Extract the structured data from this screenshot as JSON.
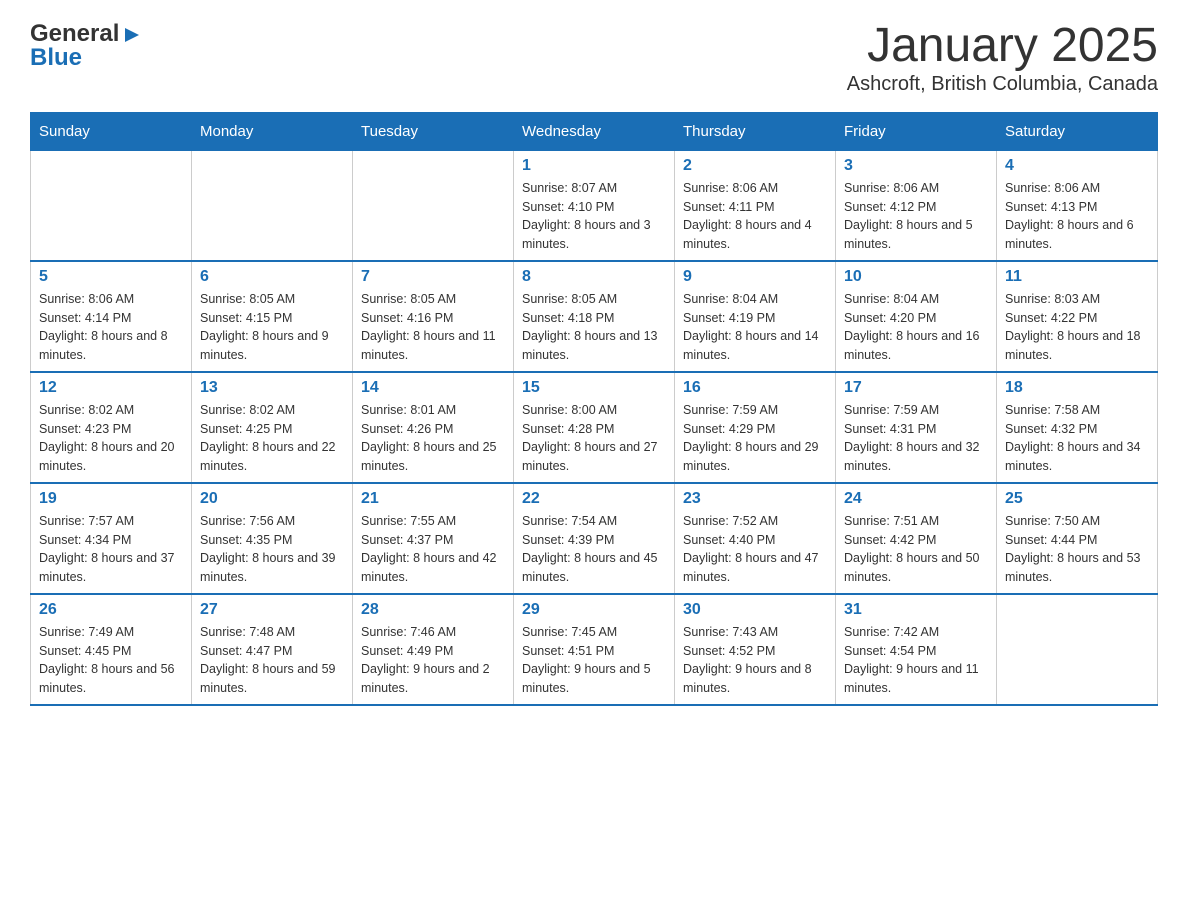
{
  "header": {
    "logo_general": "General",
    "logo_blue": "Blue",
    "title": "January 2025",
    "subtitle": "Ashcroft, British Columbia, Canada"
  },
  "calendar": {
    "days_of_week": [
      "Sunday",
      "Monday",
      "Tuesday",
      "Wednesday",
      "Thursday",
      "Friday",
      "Saturday"
    ],
    "weeks": [
      [
        {
          "day": "",
          "info": ""
        },
        {
          "day": "",
          "info": ""
        },
        {
          "day": "",
          "info": ""
        },
        {
          "day": "1",
          "info": "Sunrise: 8:07 AM\nSunset: 4:10 PM\nDaylight: 8 hours and 3 minutes."
        },
        {
          "day": "2",
          "info": "Sunrise: 8:06 AM\nSunset: 4:11 PM\nDaylight: 8 hours and 4 minutes."
        },
        {
          "day": "3",
          "info": "Sunrise: 8:06 AM\nSunset: 4:12 PM\nDaylight: 8 hours and 5 minutes."
        },
        {
          "day": "4",
          "info": "Sunrise: 8:06 AM\nSunset: 4:13 PM\nDaylight: 8 hours and 6 minutes."
        }
      ],
      [
        {
          "day": "5",
          "info": "Sunrise: 8:06 AM\nSunset: 4:14 PM\nDaylight: 8 hours and 8 minutes."
        },
        {
          "day": "6",
          "info": "Sunrise: 8:05 AM\nSunset: 4:15 PM\nDaylight: 8 hours and 9 minutes."
        },
        {
          "day": "7",
          "info": "Sunrise: 8:05 AM\nSunset: 4:16 PM\nDaylight: 8 hours and 11 minutes."
        },
        {
          "day": "8",
          "info": "Sunrise: 8:05 AM\nSunset: 4:18 PM\nDaylight: 8 hours and 13 minutes."
        },
        {
          "day": "9",
          "info": "Sunrise: 8:04 AM\nSunset: 4:19 PM\nDaylight: 8 hours and 14 minutes."
        },
        {
          "day": "10",
          "info": "Sunrise: 8:04 AM\nSunset: 4:20 PM\nDaylight: 8 hours and 16 minutes."
        },
        {
          "day": "11",
          "info": "Sunrise: 8:03 AM\nSunset: 4:22 PM\nDaylight: 8 hours and 18 minutes."
        }
      ],
      [
        {
          "day": "12",
          "info": "Sunrise: 8:02 AM\nSunset: 4:23 PM\nDaylight: 8 hours and 20 minutes."
        },
        {
          "day": "13",
          "info": "Sunrise: 8:02 AM\nSunset: 4:25 PM\nDaylight: 8 hours and 22 minutes."
        },
        {
          "day": "14",
          "info": "Sunrise: 8:01 AM\nSunset: 4:26 PM\nDaylight: 8 hours and 25 minutes."
        },
        {
          "day": "15",
          "info": "Sunrise: 8:00 AM\nSunset: 4:28 PM\nDaylight: 8 hours and 27 minutes."
        },
        {
          "day": "16",
          "info": "Sunrise: 7:59 AM\nSunset: 4:29 PM\nDaylight: 8 hours and 29 minutes."
        },
        {
          "day": "17",
          "info": "Sunrise: 7:59 AM\nSunset: 4:31 PM\nDaylight: 8 hours and 32 minutes."
        },
        {
          "day": "18",
          "info": "Sunrise: 7:58 AM\nSunset: 4:32 PM\nDaylight: 8 hours and 34 minutes."
        }
      ],
      [
        {
          "day": "19",
          "info": "Sunrise: 7:57 AM\nSunset: 4:34 PM\nDaylight: 8 hours and 37 minutes."
        },
        {
          "day": "20",
          "info": "Sunrise: 7:56 AM\nSunset: 4:35 PM\nDaylight: 8 hours and 39 minutes."
        },
        {
          "day": "21",
          "info": "Sunrise: 7:55 AM\nSunset: 4:37 PM\nDaylight: 8 hours and 42 minutes."
        },
        {
          "day": "22",
          "info": "Sunrise: 7:54 AM\nSunset: 4:39 PM\nDaylight: 8 hours and 45 minutes."
        },
        {
          "day": "23",
          "info": "Sunrise: 7:52 AM\nSunset: 4:40 PM\nDaylight: 8 hours and 47 minutes."
        },
        {
          "day": "24",
          "info": "Sunrise: 7:51 AM\nSunset: 4:42 PM\nDaylight: 8 hours and 50 minutes."
        },
        {
          "day": "25",
          "info": "Sunrise: 7:50 AM\nSunset: 4:44 PM\nDaylight: 8 hours and 53 minutes."
        }
      ],
      [
        {
          "day": "26",
          "info": "Sunrise: 7:49 AM\nSunset: 4:45 PM\nDaylight: 8 hours and 56 minutes."
        },
        {
          "day": "27",
          "info": "Sunrise: 7:48 AM\nSunset: 4:47 PM\nDaylight: 8 hours and 59 minutes."
        },
        {
          "day": "28",
          "info": "Sunrise: 7:46 AM\nSunset: 4:49 PM\nDaylight: 9 hours and 2 minutes."
        },
        {
          "day": "29",
          "info": "Sunrise: 7:45 AM\nSunset: 4:51 PM\nDaylight: 9 hours and 5 minutes."
        },
        {
          "day": "30",
          "info": "Sunrise: 7:43 AM\nSunset: 4:52 PM\nDaylight: 9 hours and 8 minutes."
        },
        {
          "day": "31",
          "info": "Sunrise: 7:42 AM\nSunset: 4:54 PM\nDaylight: 9 hours and 11 minutes."
        },
        {
          "day": "",
          "info": ""
        }
      ]
    ]
  }
}
